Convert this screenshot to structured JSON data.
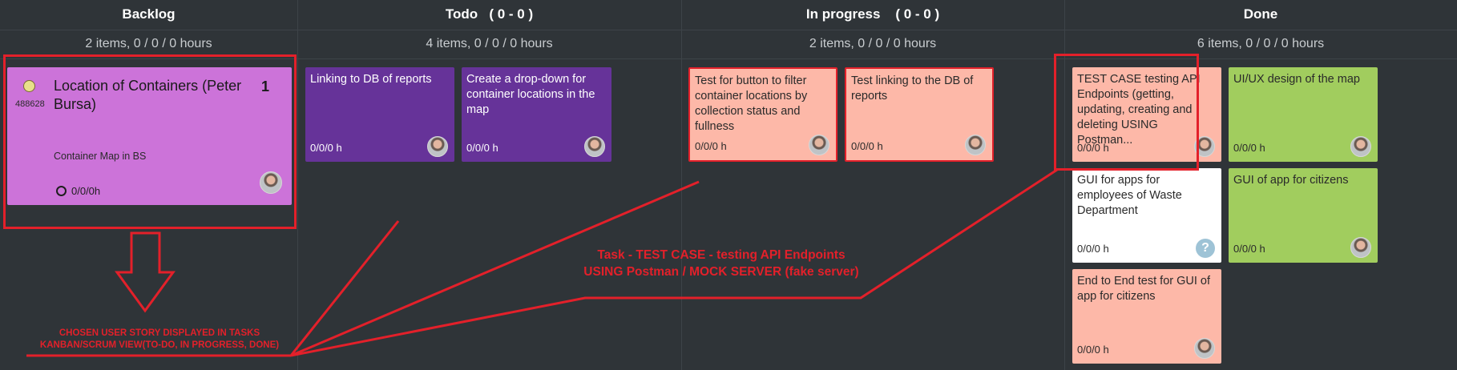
{
  "columns": [
    {
      "title": "Backlog",
      "subtitle": "2 items, 0 / 0 / 0 hours"
    },
    {
      "title": "Todo   ( 0 - 0 )",
      "subtitle": "4 items, 0 / 0 / 0 hours"
    },
    {
      "title": "In progress    ( 0 - 0 )",
      "subtitle": "2 items, 0 / 0 / 0 hours"
    },
    {
      "title": "Done",
      "subtitle": "6 items, 0 / 0 / 0 hours"
    }
  ],
  "user_story": {
    "id": "488628",
    "title": "Location of Containers (Peter Bursa)",
    "points": "1",
    "epic": "Container Map in BS",
    "hours": "0/0/0h",
    "color": "#cc73d9"
  },
  "todo": [
    {
      "title": "Linking to DB of reports",
      "hours": "0/0/0 h"
    },
    {
      "title": "Create a drop-down for container locations in the map",
      "hours": "0/0/0 h"
    }
  ],
  "in_progress": [
    {
      "title": "Test for button to filter container locations by collection status and fullness",
      "hours": "0/0/0 h"
    },
    {
      "title": "Test linking to the DB of reports",
      "hours": "0/0/0 h"
    }
  ],
  "done": [
    {
      "title": "TEST CASE testing API Endpoints (getting, updating, creating and deleting USING Postman...",
      "hours": "0/0/0 h"
    },
    {
      "title": "UI/UX design of the map",
      "hours": "0/0/0 h"
    },
    {
      "title": "GUI for apps for employees of Waste Department",
      "hours": "0/0/0 h"
    },
    {
      "title": "GUI of app for citizens",
      "hours": "0/0/0 h"
    },
    {
      "title": "End to End test for GUI of app for citizens",
      "hours": "0/0/0 h"
    }
  ],
  "unassigned_icon": "?",
  "annotations": {
    "user_story_note_line1": "CHOSEN USER STORY DISPLAYED IN TASKS",
    "user_story_note_line2": "KANBAN/SCRUM VIEW(TO-DO, IN PROGRESS, DONE)",
    "task_note_line1": "Task - TEST CASE - testing API Endpoints",
    "task_note_line2": "USING Postman / MOCK SERVER (fake server)",
    "color": "#e3202a"
  },
  "colors": {
    "background": "#2f3438",
    "todo_card": "#663399",
    "salmon_card": "#fdb8a8",
    "green_card": "#a1cd5e",
    "white_card": "#ffffff",
    "user_story_card": "#cc73d9"
  }
}
